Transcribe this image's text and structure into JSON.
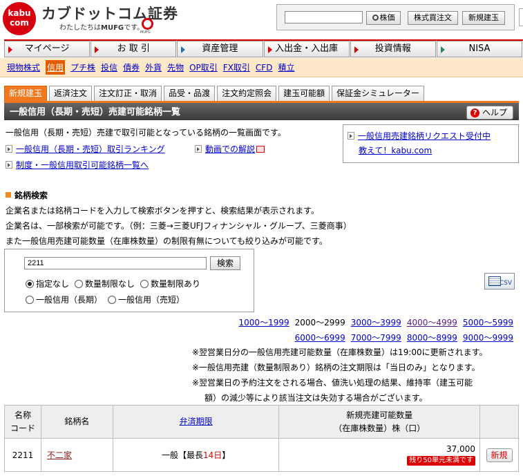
{
  "header": {
    "logo_top": "kabu",
    "logo_bottom": "com",
    "brand": "カブドットコム証券",
    "tagline_pre": "わたしたちは",
    "tagline_bold": "MUFG",
    "tagline_post": "です。",
    "mufg_small": "MUFG",
    "search_value": "",
    "btn_quote": "株価",
    "btn_stock_order": "株式買注文",
    "btn_new_margin": "新規建玉"
  },
  "main_nav": [
    "マイページ",
    "お 取 引",
    "資産管理",
    "入出金・入出庫",
    "投資情報",
    "NISA"
  ],
  "sub_nav": [
    "現物株式",
    "信用",
    "プチ株",
    "投信",
    "債券",
    "外貨",
    "先物",
    "OP取引",
    "FX取引",
    "CFD",
    "積立"
  ],
  "page_tabs": [
    "新規建玉",
    "返済注文",
    "注文訂正・取消",
    "品受・品渡",
    "注文約定照会",
    "建玉可能額",
    "保証金シミュレーター"
  ],
  "title": "一般信用（長期・売短）売建可能銘柄一覧",
  "help": "ヘルプ",
  "intro": {
    "text": "一般信用（長期・売短）売建で取引可能となっている銘柄の一覧画面です。",
    "link_ranking": "一般信用（長期・売短）取引ランキング",
    "link_video": "動画での解説",
    "link_list": "制度・一般信用取引可能銘柄一覧へ",
    "request_line1": "一般信用売建銘柄リクエスト受付中",
    "request_line2": "教えて！kabu.com"
  },
  "search": {
    "heading": "銘柄検索",
    "desc1": "企業名または銘柄コードを入力して検索ボタンを押すと、検索結果が表示されます。",
    "desc2": "企業名は、一部検索が可能です。（例：三菱→三菱UFJフィナンシャル・グループ、三菱商事）",
    "desc3": "また一般信用売建可能数量（在庫株数量）の制限有無についても絞り込みが可能です。",
    "code_value": "2211",
    "button": "検索",
    "radio_none": "指定なし",
    "radio_unlimited": "数量制限なし",
    "radio_limited": "数量制限あり",
    "radio_long": "一般信用（長期）",
    "radio_short": "一般信用（売短）",
    "csv": "CSV"
  },
  "ranges_row1": [
    "1000〜1999",
    "2000〜2999",
    "3000〜3999",
    "4000〜4999",
    "5000〜5999"
  ],
  "ranges_row2": [
    "6000〜6999",
    "7000〜7999",
    "8000〜8999",
    "9000〜9999"
  ],
  "notes": [
    "※翌営業日分の一般信用売建可能数量（在庫株数量）は19:00に更新されます。",
    "※一般信用売建（数量制限あり）銘柄の注文期限は「当日のみ」となります。",
    "※翌営業日の予約注文をされる場合、値洗い処理の結果、維持率（建玉可能",
    "額）の減少等により該当注文は失効する場合がございます。"
  ],
  "table": {
    "h_code_1": "名称",
    "h_code_2": "コード",
    "h_name": "銘柄名",
    "h_term": "弁済期限",
    "h_qty_1": "新規売建可能数量",
    "h_qty_2": "（在庫株数量）株（口）",
    "rows": [
      {
        "code": "2211",
        "name": "不二家",
        "term_pre": "一般【最長",
        "term_num": "14日",
        "term_post": "】",
        "qty": "37,000",
        "badge": "残り50単元未満です",
        "action": "新規"
      }
    ]
  }
}
